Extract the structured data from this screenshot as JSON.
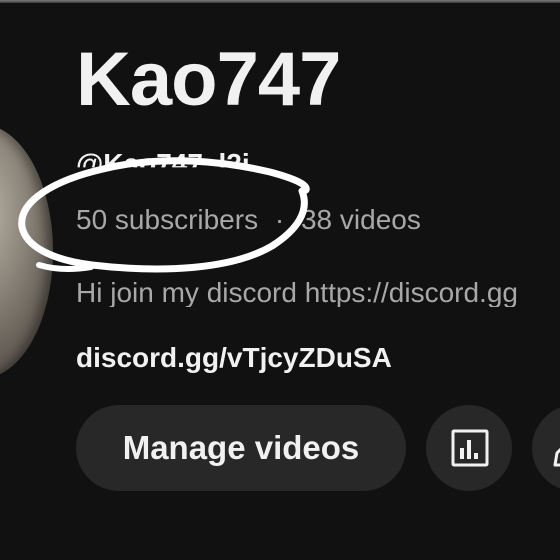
{
  "channel": {
    "title": "Kao747",
    "handle": "@Kao747_l2j",
    "subscribers": "50 subscribers",
    "separator": "·",
    "videos": "38 videos",
    "description": "Hi join my discord https://discord.gg",
    "link": "discord.gg/vTjcyZDuSA"
  },
  "actions": {
    "manage_label": "Manage videos",
    "analytics_icon": "bar-chart-icon",
    "edit_icon": "edit-icon"
  },
  "annotation": {
    "type": "hand-drawn circle",
    "target": "subscriber count",
    "color": "#ffffff"
  },
  "colors": {
    "background": "#111111",
    "primary_text": "#f1f1f1",
    "secondary_text": "#a8a8a8",
    "button_bg": "#282828"
  }
}
